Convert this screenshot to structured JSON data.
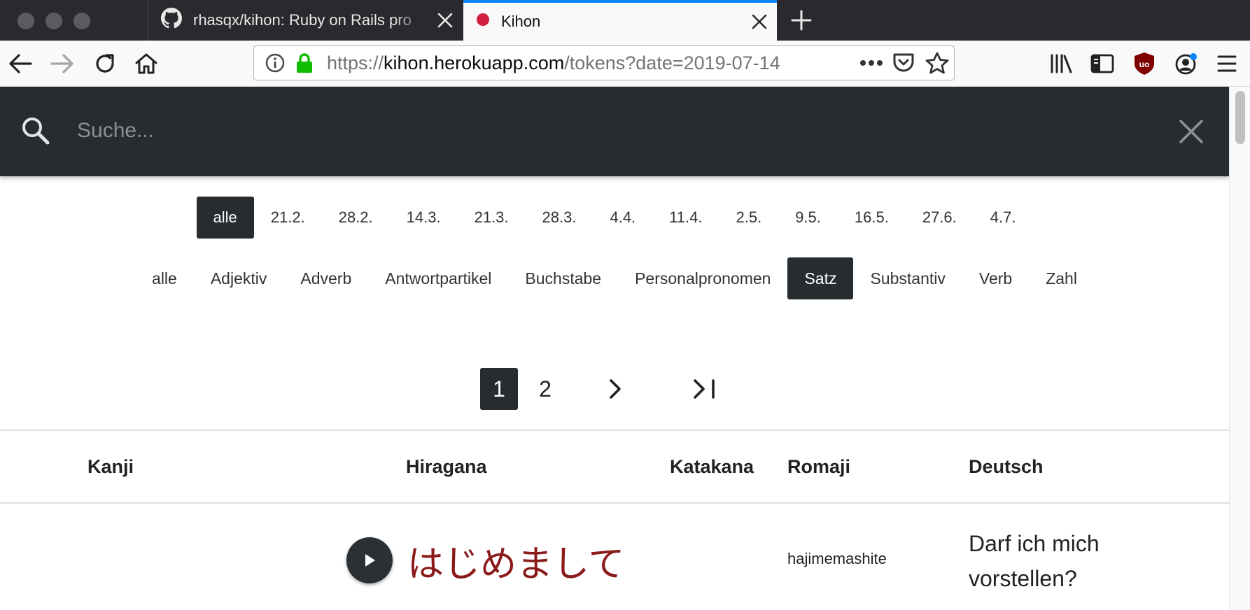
{
  "browser": {
    "tabs": [
      {
        "title": "rhasqx/kihon: Ruby on Rails pro",
        "favicon": "github-icon",
        "active": false
      },
      {
        "title": "Kihon",
        "favicon": "red-circle-icon",
        "active": true
      }
    ],
    "url": {
      "scheme": "https://",
      "host": "kihon.herokuapp.com",
      "path": "/tokens?date=2019-07-14"
    },
    "accent_color": "#0a84ff"
  },
  "search": {
    "placeholder": "Suche..."
  },
  "date_filters": [
    {
      "label": "alle",
      "active": true
    },
    {
      "label": "21.2.",
      "active": false
    },
    {
      "label": "28.2.",
      "active": false
    },
    {
      "label": "14.3.",
      "active": false
    },
    {
      "label": "21.3.",
      "active": false
    },
    {
      "label": "28.3.",
      "active": false
    },
    {
      "label": "4.4.",
      "active": false
    },
    {
      "label": "11.4.",
      "active": false
    },
    {
      "label": "2.5.",
      "active": false
    },
    {
      "label": "9.5.",
      "active": false
    },
    {
      "label": "16.5.",
      "active": false
    },
    {
      "label": "27.6.",
      "active": false
    },
    {
      "label": "4.7.",
      "active": false
    }
  ],
  "type_filters": [
    {
      "label": "alle",
      "active": false
    },
    {
      "label": "Adjektiv",
      "active": false
    },
    {
      "label": "Adverb",
      "active": false
    },
    {
      "label": "Antwortpartikel",
      "active": false
    },
    {
      "label": "Buchstabe",
      "active": false
    },
    {
      "label": "Personalpronomen",
      "active": false
    },
    {
      "label": "Satz",
      "active": true
    },
    {
      "label": "Substantiv",
      "active": false
    },
    {
      "label": "Verb",
      "active": false
    },
    {
      "label": "Zahl",
      "active": false
    }
  ],
  "pagination": {
    "pages": [
      "1",
      "2"
    ],
    "current": "1",
    "next_icon": "chevron-right-icon",
    "last_icon": "last-page-icon"
  },
  "table": {
    "headers": {
      "kanji": "Kanji",
      "hiragana": "Hiragana",
      "katakana": "Katakana",
      "romaji": "Romaji",
      "deutsch": "Deutsch"
    },
    "rows": [
      {
        "kanji": "",
        "hiragana": "はじめまして",
        "katakana": "",
        "romaji": "hajimemashite",
        "deutsch": "Darf ich mich vorstellen?"
      }
    ]
  },
  "colors": {
    "dark": "#262c2f",
    "hiragana_text": "#8b1a1a"
  }
}
